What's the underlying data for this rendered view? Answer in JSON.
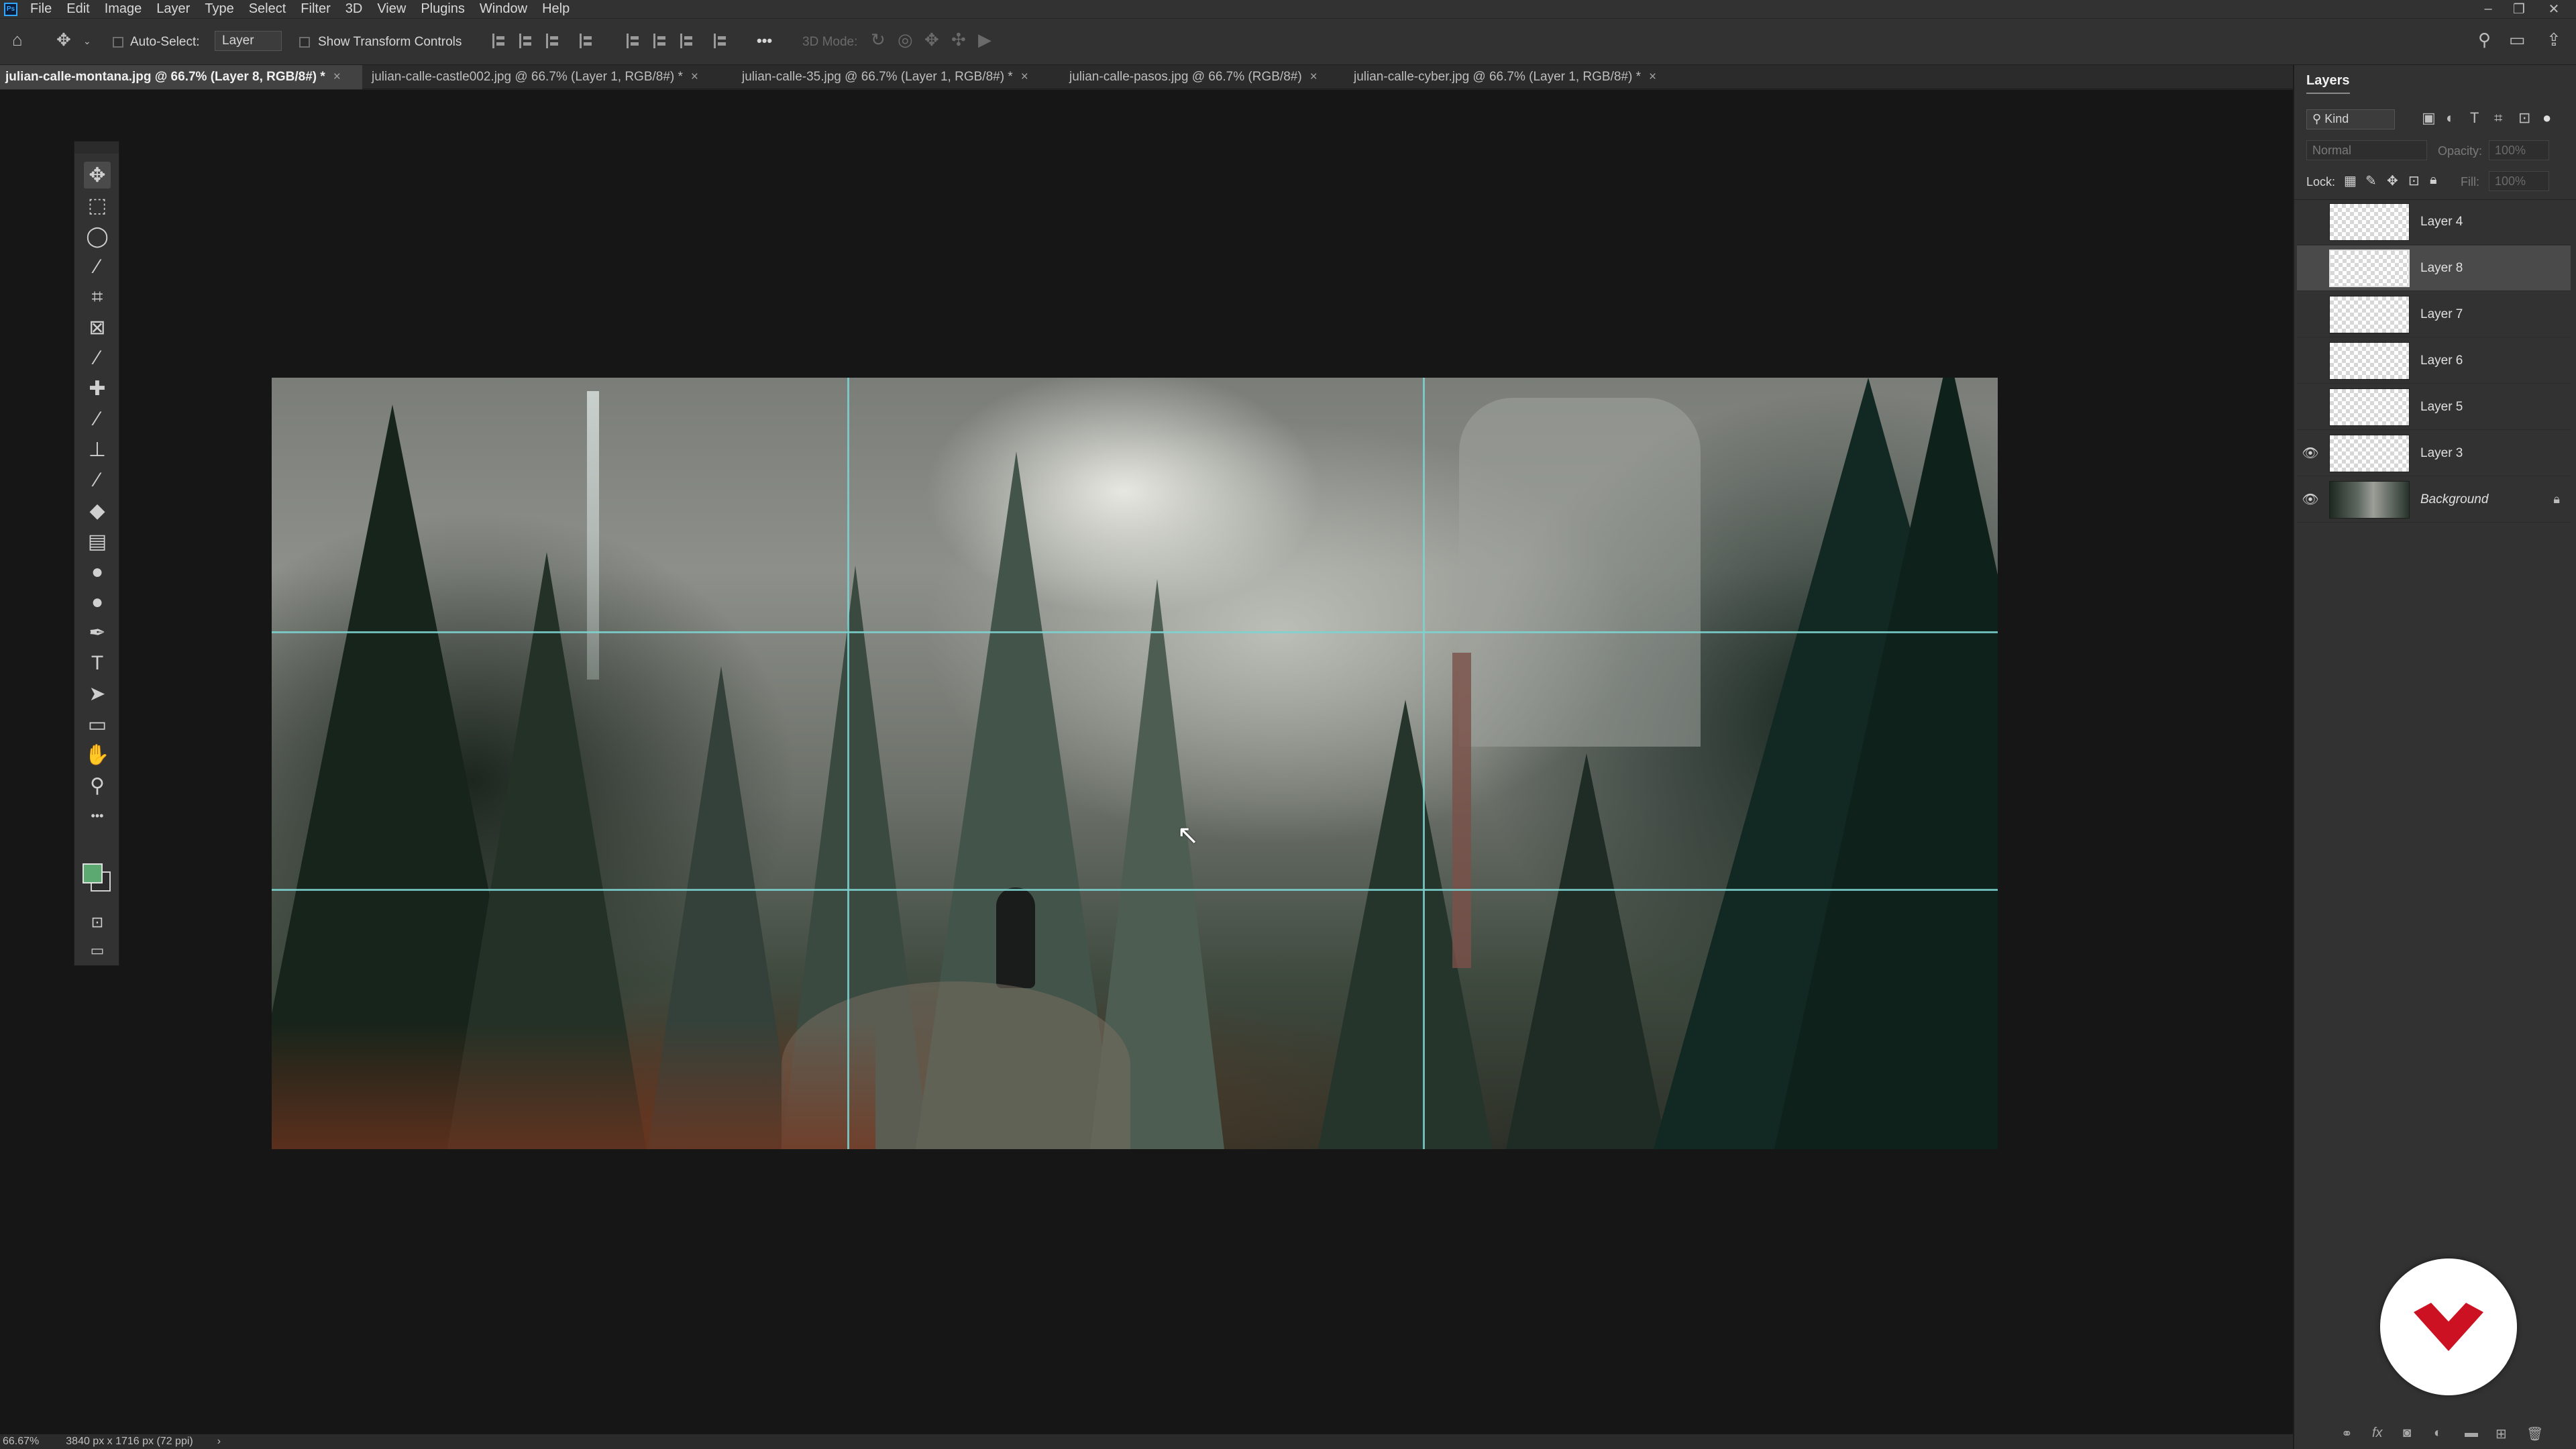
{
  "app": {
    "menus": [
      "File",
      "Edit",
      "Image",
      "Layer",
      "Type",
      "Select",
      "Filter",
      "3D",
      "View",
      "Plugins",
      "Window",
      "Help"
    ]
  },
  "window_controls": {
    "minimize": "–",
    "restore": "❐",
    "close": "✕"
  },
  "options_bar": {
    "auto_select_label": "Auto-Select:",
    "auto_select_target": "Layer",
    "show_transform_label": "Show Transform Controls",
    "mode_3d_label": "3D Mode:",
    "more_label": "•••"
  },
  "tabs": [
    {
      "label": "julian-calle-montana.jpg @ 66.7% (Layer 8, RGB/8#) *",
      "close": "×"
    },
    {
      "label": "julian-calle-castle002.jpg @ 66.7% (Layer 1, RGB/8#) *",
      "close": "×"
    },
    {
      "label": "julian-calle-35.jpg @ 66.7% (Layer 1, RGB/8#) *",
      "close": "×"
    },
    {
      "label": "julian-calle-pasos.jpg @ 66.7% (RGB/8#)",
      "close": "×"
    },
    {
      "label": "julian-calle-cyber.jpg @ 66.7% (Layer 1, RGB/8#) *",
      "close": "×"
    }
  ],
  "toolbar": {
    "tools": [
      {
        "name": "move-tool",
        "glyph": "✥"
      },
      {
        "name": "marquee-tool",
        "glyph": "⬚"
      },
      {
        "name": "lasso-tool",
        "glyph": "◯"
      },
      {
        "name": "magic-wand-tool",
        "glyph": "⁄"
      },
      {
        "name": "crop-tool",
        "glyph": "⌗"
      },
      {
        "name": "frame-tool",
        "glyph": "⊠"
      },
      {
        "name": "eyedropper-tool",
        "glyph": "⁄"
      },
      {
        "name": "healing-brush-tool",
        "glyph": "✚"
      },
      {
        "name": "brush-tool",
        "glyph": "⁄"
      },
      {
        "name": "clone-stamp-tool",
        "glyph": "⊥"
      },
      {
        "name": "history-brush-tool",
        "glyph": "⁄"
      },
      {
        "name": "eraser-tool",
        "glyph": "◆"
      },
      {
        "name": "gradient-tool",
        "glyph": "▤"
      },
      {
        "name": "blur-tool",
        "glyph": "●"
      },
      {
        "name": "dodge-tool",
        "glyph": "●"
      },
      {
        "name": "pen-tool",
        "glyph": "✒"
      },
      {
        "name": "type-tool",
        "glyph": "T"
      },
      {
        "name": "path-selection-tool",
        "glyph": "➤"
      },
      {
        "name": "rectangle-tool",
        "glyph": "▭"
      },
      {
        "name": "hand-tool",
        "glyph": "✋"
      },
      {
        "name": "zoom-tool",
        "glyph": "⚲"
      },
      {
        "name": "edit-toolbar",
        "glyph": "•••"
      }
    ],
    "foreground_color": "#5caa72"
  },
  "status_bar": {
    "zoom": "66.67%",
    "doc_size": "3840 px x 1716 px (72 ppi)",
    "arrow": "›"
  },
  "layers_panel": {
    "title": "Layers",
    "filter_kind": "Kind",
    "blend_mode": "Normal",
    "opacity_label": "Opacity:",
    "opacity_value": "100%",
    "lock_label": "Lock:",
    "fill_label": "Fill:",
    "fill_value": "100%",
    "layers": [
      {
        "name": "Layer 4",
        "visible": false,
        "selected": false
      },
      {
        "name": "Layer 8",
        "visible": false,
        "selected": true
      },
      {
        "name": "Layer 7",
        "visible": false,
        "selected": false
      },
      {
        "name": "Layer 6",
        "visible": false,
        "selected": false
      },
      {
        "name": "Layer 5",
        "visible": false,
        "selected": false
      },
      {
        "name": "Layer 3",
        "visible": true,
        "selected": false
      },
      {
        "name": "Background",
        "visible": true,
        "selected": false,
        "locked": true
      }
    ],
    "footer_icons": [
      "link-icon",
      "fx-icon",
      "mask-icon",
      "adjustment-icon",
      "folder-icon",
      "new-layer-icon",
      "trash-icon"
    ]
  },
  "colors": {
    "accent_guide": "#7cd2d0",
    "badge_red": "#cc1122"
  }
}
